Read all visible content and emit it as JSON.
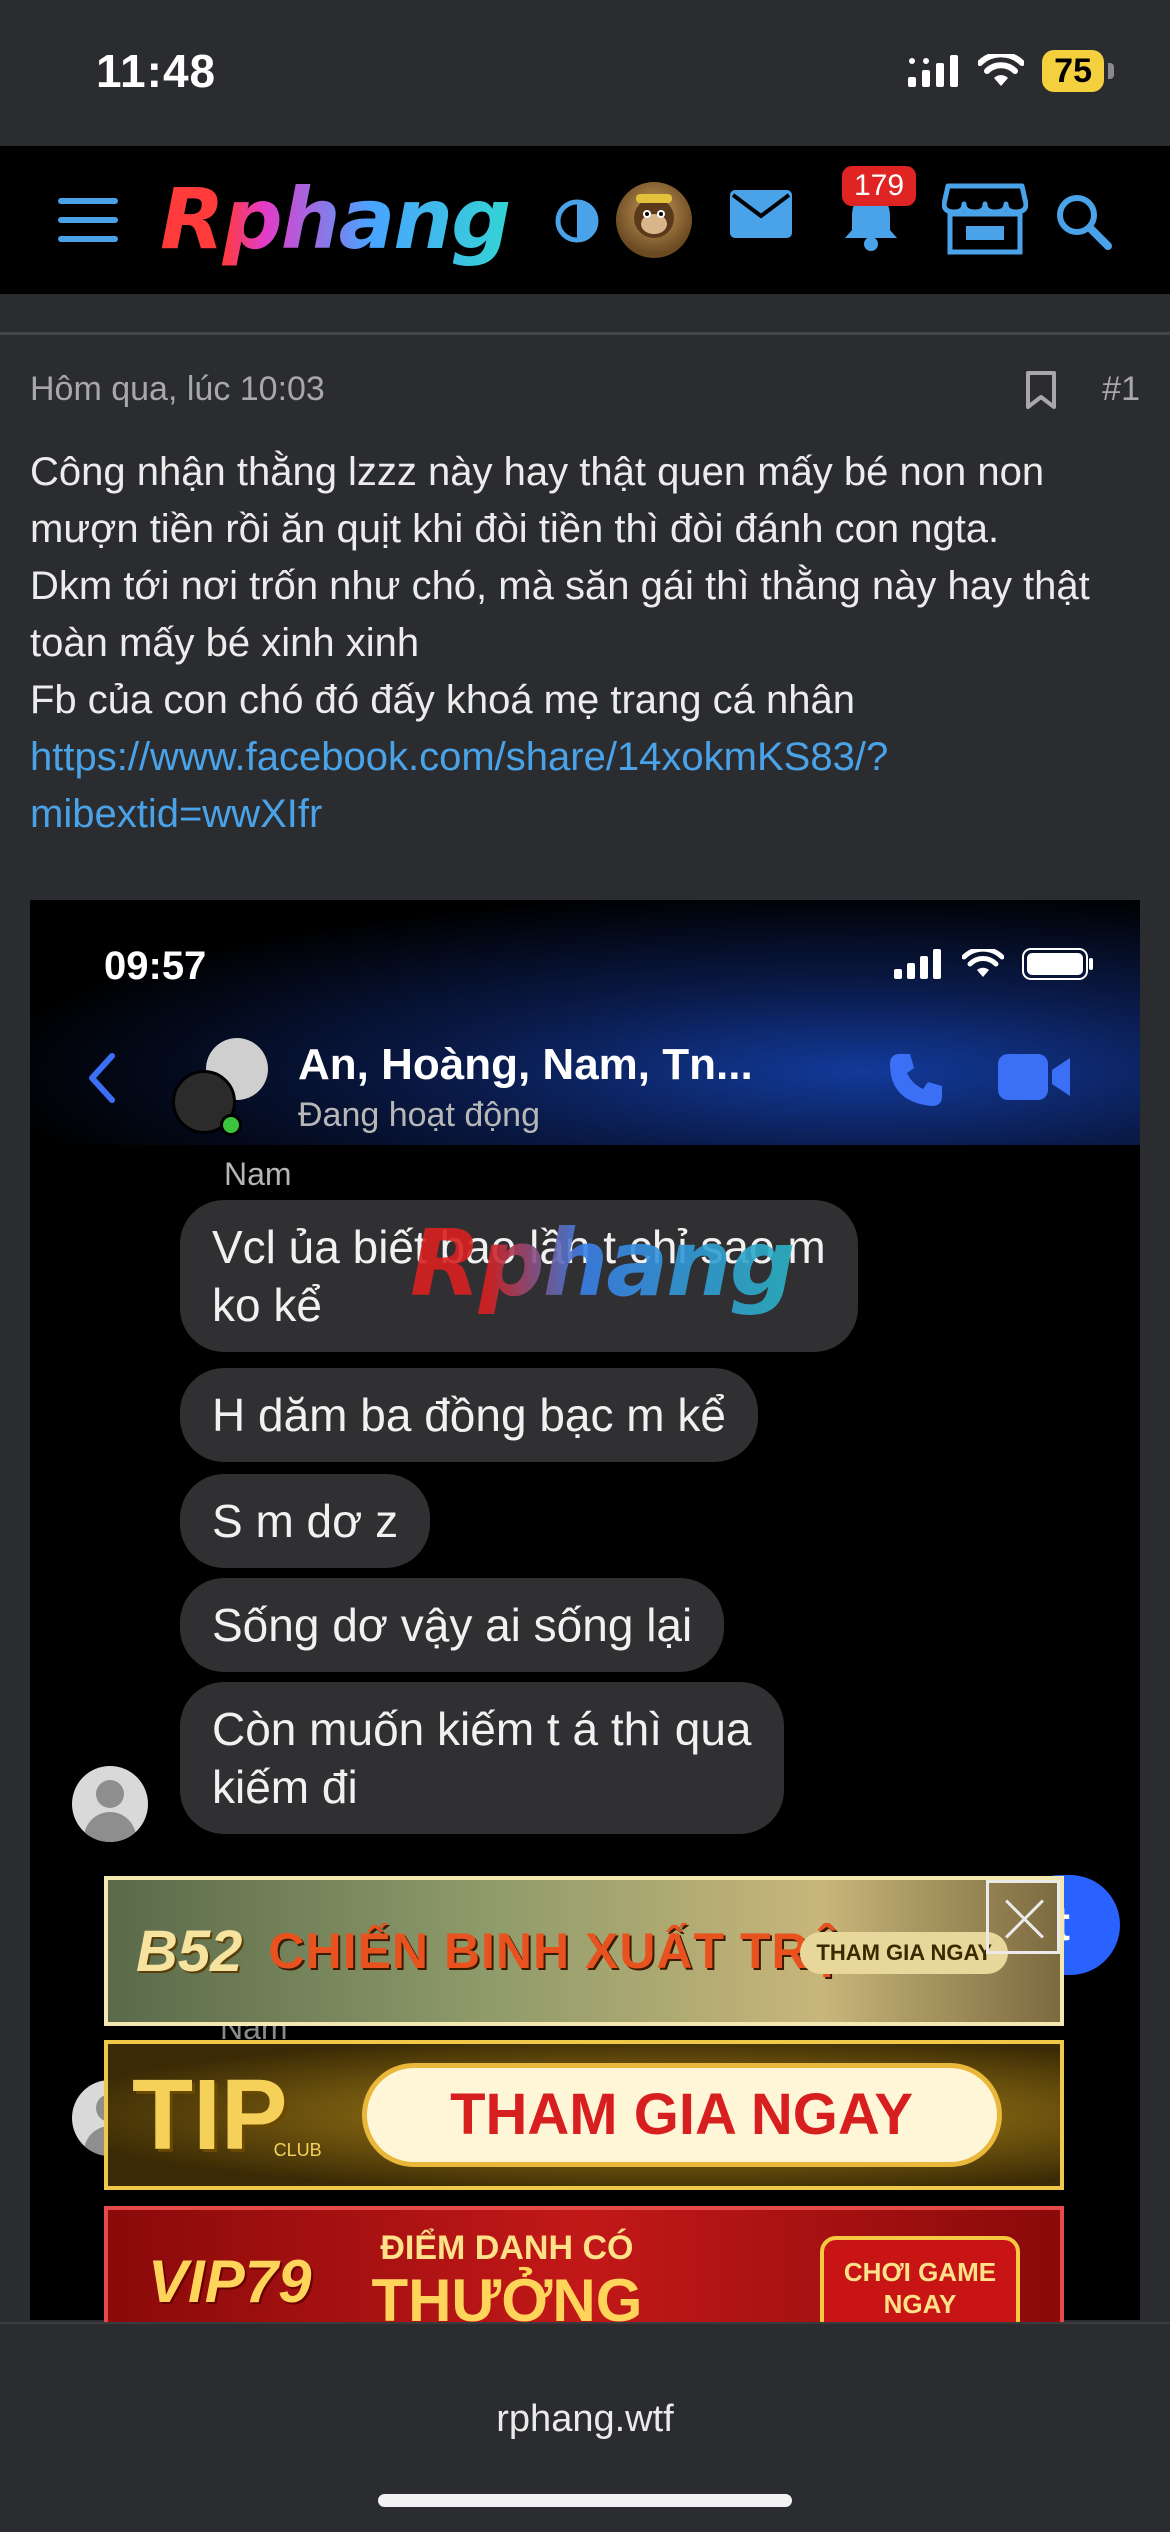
{
  "status_bar": {
    "time": "11:48",
    "battery": "75"
  },
  "header": {
    "logo": "Rphang",
    "notification_count": "179",
    "icons": [
      "menu-icon",
      "theme-toggle-icon",
      "avatar",
      "mail-icon",
      "bell-icon",
      "store-icon",
      "search-icon"
    ]
  },
  "post": {
    "date": "Hôm qua, lúc 10:03",
    "number": "#1",
    "lines": [
      "Công nhận thằng lzzz này hay thật quen mấy bé non non",
      "mượn tiền rồi ăn quịt khi đòi tiền thì đòi đánh con ngta.",
      "Dkm tới nơi trốn như chó, mà săn gái thì thằng này hay thật",
      "toàn mấy bé xinh xinh",
      "Fb của con chó đó đấy khoá mẹ trang cá nhân"
    ],
    "link_line1": "https://www.facebook.com/share/14xokmKS83/?",
    "link_line2": "mibextid=wwXIfr"
  },
  "screenshot": {
    "time": "09:57",
    "chat_name": "An, Hoàng, Nam, Tn...",
    "chat_status": "Đang hoạt động",
    "sender": "Nam",
    "sender2": "Nam",
    "watermark": "Rphang",
    "sent_fragment": "t",
    "messages": [
      [
        "Vcl ủa biết bao lần t chỉ sao m",
        "ko kể"
      ],
      [
        "H dăm ba đồng bạc m kể"
      ],
      [
        "S m dơ z"
      ],
      [
        "Sống dơ vậy ai sống lại"
      ],
      [
        "Còn muốn kiếm t á thì qua",
        "kiếm đi"
      ]
    ]
  },
  "ads": {
    "ad1": {
      "logo": "B52",
      "text": "CHIẾN BINH XUẤT TRẬN",
      "button": "THAM GIA NGAY"
    },
    "ad2": {
      "logo": "TIP",
      "club": "CLUB",
      "button": "THAM GIA NGAY"
    },
    "ad3": {
      "logo": "VIP79",
      "small": "ĐIỂM DANH CÓ",
      "big": "THƯỞNG",
      "button_line1": "CHƠI GAME",
      "button_line2": "NGAY"
    }
  },
  "browser": {
    "url": "rphang.wtf"
  },
  "colors": {
    "accent": "#4aa3e8",
    "badge": "#e02424",
    "bubble": "#303033",
    "messenger_blue": "#2a62ff"
  }
}
